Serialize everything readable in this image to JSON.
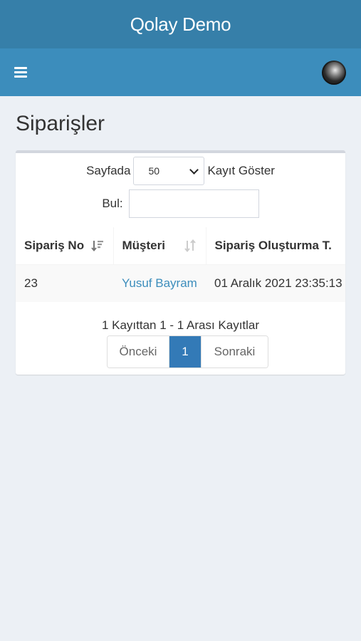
{
  "header": {
    "app_title": "Qolay Demo"
  },
  "navbar": {
    "menu_icon": "hamburger-icon",
    "avatar_icon": "user-avatar"
  },
  "page": {
    "title": "Siparişler"
  },
  "table_controls": {
    "length_prefix": "Sayfada",
    "length_value": "50",
    "length_suffix": "Kayıt Göster",
    "search_label": "Bul:",
    "search_value": ""
  },
  "table": {
    "columns": [
      {
        "label": "Sipariş No",
        "sort_icon": "sort-desc-active-icon"
      },
      {
        "label": "Müşteri",
        "sort_icon": "sort-both-icon"
      },
      {
        "label": "Sipariş Oluşturma T.",
        "sort_icon": "sort-both-icon"
      }
    ],
    "rows": [
      {
        "order_no": "23",
        "customer": "Yusuf Bayram",
        "created_at": "01 Aralık 2021 23:35:13"
      }
    ]
  },
  "info_text": "1 Kayıttan 1 - 1 Arası Kayıtlar",
  "pagination": {
    "prev": "Önceki",
    "current": "1",
    "next": "Sonraki"
  },
  "colors": {
    "header_bg": "#367fa9",
    "navbar_bg": "#3c8dbc",
    "link": "#3c8dbc",
    "active_page": "#337ab7"
  }
}
